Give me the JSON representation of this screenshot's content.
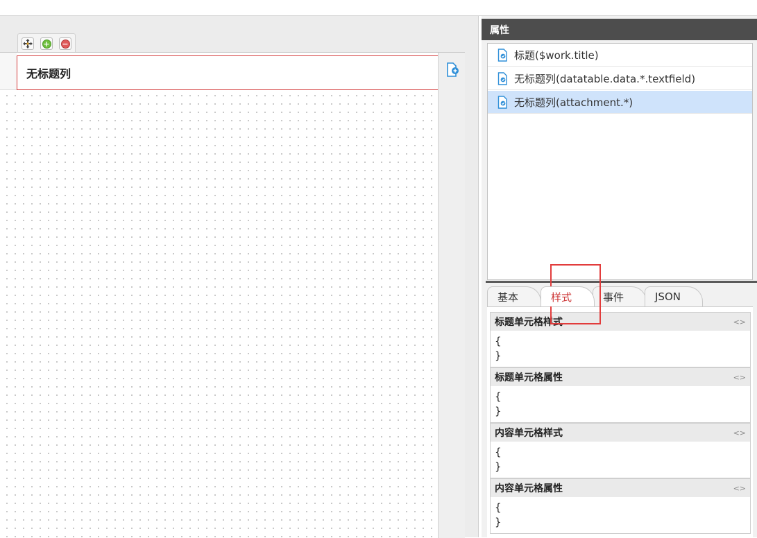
{
  "designer": {
    "title_cell_text": "无标题列"
  },
  "panel": {
    "header": "属性",
    "tree_items": [
      {
        "label": "标题($work.title)",
        "selected": false
      },
      {
        "label": "无标题列(datatable.data.*.textfield)",
        "selected": false
      },
      {
        "label": "无标题列(attachment.*)",
        "selected": true
      }
    ],
    "tabs": [
      {
        "label": "基本",
        "active": false
      },
      {
        "label": "样式",
        "active": true
      },
      {
        "label": "事件",
        "active": false
      },
      {
        "label": "JSON",
        "active": false
      }
    ],
    "sections": [
      {
        "title": "标题单元格样式",
        "open": "{",
        "close": "}"
      },
      {
        "title": "标题单元格属性",
        "open": "{",
        "close": "}"
      },
      {
        "title": "内容单元格样式",
        "open": "{",
        "close": "}"
      },
      {
        "title": "内容单元格属性",
        "open": "{",
        "close": "}"
      }
    ],
    "code_toggle_glyph": "<>"
  },
  "colors": {
    "header_bg": "#4d4d4d",
    "selected_row": "#cfe3fb",
    "active_tab_text": "#cc3333",
    "title_cell_border": "#d33a3a",
    "highlight_box": "#e23c3c",
    "icon_blue": "#2f8fd8"
  },
  "icons": [
    "move-icon",
    "add-icon",
    "remove-icon",
    "add-column-icon",
    "file-icon",
    "code-toggle-icon"
  ]
}
